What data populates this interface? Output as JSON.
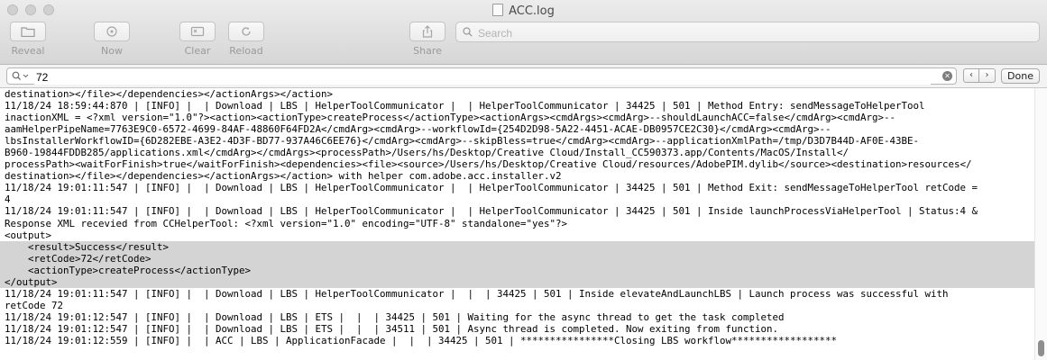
{
  "window": {
    "title": "ACC.log"
  },
  "toolbar": {
    "reveal": "Reveal",
    "now": "Now",
    "clear": "Clear",
    "reload": "Reload",
    "share": "Share",
    "search_placeholder": "Search"
  },
  "findbar": {
    "query": "72",
    "done": "Done",
    "prev": "‹",
    "next": "›"
  },
  "log": {
    "lines_before": [
      "destination></file></dependencies></actionArgs></action>",
      "11/18/24 18:59:44:870 | [INFO] |  | Download | LBS | HelperToolCommunicator |  | HelperToolCommunicator | 34425 | 501 | Method Entry: sendMessageToHelperTool",
      "inactionXML = <?xml version=\"1.0\"?><action><actionType>createProcess</actionType><actionArgs><cmdArgs><cmdArg>--shouldLaunchACC=false</cmdArg><cmdArg>--",
      "aamHelperPipeName=7763E9C0-6572-4699-84AF-48860F64FD2A</cmdArg><cmdArg>--workflowId={254D2D98-5A22-4451-ACAE-DB0957CE2C30}</cmdArg><cmdArg>--",
      "lbsInstallerWorkflowID={6D282EBE-A3E2-4D3F-BD77-937A46C6EE76}</cmdArg><cmdArg>--skipBless=true</cmdArg><cmdArg>--applicationXmlPath=/tmp/D3D7B44D-AF0E-43BE-",
      "B960-19844FDDB285/applications.xml</cmdArg></cmdArgs><processPath>/Users/hs/Desktop/Creative Cloud/Install_CC590373.app/Contents/MacOS/Install</",
      "processPath><waitForFinish>true</waitForFinish><dependencies><file><source>/Users/hs/Desktop/Creative Cloud/resources/AdobePIM.dylib</source><destination>resources</",
      "destination></file></dependencies></actionArgs></action> with helper com.adobe.acc.installer.v2",
      "11/18/24 19:01:11:547 | [INFO] |  | Download | LBS | HelperToolCommunicator |  | HelperToolCommunicator | 34425 | 501 | Method Exit: sendMessageToHelperTool retCode =",
      "4",
      "11/18/24 19:01:11:547 | [INFO] |  | Download | LBS | HelperToolCommunicator |  | HelperToolCommunicator | 34425 | 501 | Inside launchProcessViaHelperTool | Status:4 &",
      "Response XML recevied from CCHelperTool: <?xml version=\"1.0\" encoding=\"UTF-8\" standalone=\"yes\"?>",
      "<output>"
    ],
    "lines_highlight": [
      "    <result>Success</result>",
      "    <retCode>72</retCode>",
      "    <actionType>createProcess</actionType>",
      "</output>"
    ],
    "lines_after": [
      "11/18/24 19:01:11:547 | [INFO] |  | Download | LBS | HelperToolCommunicator |  |  | 34425 | 501 | Inside elevateAndLaunchLBS | Launch process was successful with",
      "retCode 72",
      "11/18/24 19:01:12:547 | [INFO] |  | Download | LBS | ETS |  |  | 34425 | 501 | Waiting for the async thread to get the task completed",
      "11/18/24 19:01:12:547 | [INFO] |  | Download | LBS | ETS |  |  | 34511 | 501 | Async thread is completed. Now exiting from function.",
      "11/18/24 19:01:12:559 | [INFO] |  | ACC | LBS | ApplicationFacade |  |  | 34425 | 501 | ****************Closing LBS workflow******************"
    ]
  }
}
